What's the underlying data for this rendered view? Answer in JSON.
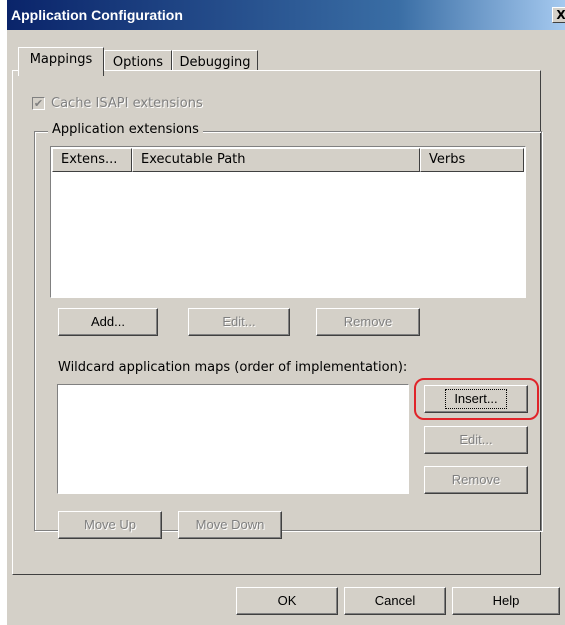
{
  "window": {
    "title": "Application Configuration",
    "close_label": "X"
  },
  "tabs": [
    {
      "label": "Mappings",
      "active": true
    },
    {
      "label": "Options",
      "active": false
    },
    {
      "label": "Debugging",
      "active": false
    }
  ],
  "cache_isapi": {
    "label": "Cache ISAPI extensions",
    "checked": true,
    "enabled": false
  },
  "app_extensions": {
    "group_label": "Application extensions",
    "columns": [
      "Extens...",
      "Executable Path",
      "Verbs"
    ],
    "rows": [],
    "add_label": "Add...",
    "edit_label": "Edit...",
    "remove_label": "Remove"
  },
  "wildcard": {
    "label": "Wildcard application maps (order of implementation):",
    "items": [],
    "insert_label": "Insert...",
    "edit_label": "Edit...",
    "remove_label": "Remove",
    "move_up_label": "Move Up",
    "move_down_label": "Move Down"
  },
  "footer": {
    "ok_label": "OK",
    "cancel_label": "Cancel",
    "help_label": "Help"
  },
  "colors": {
    "dialog_face": "#d4d0c8",
    "title_gradient_start": "#0a246a",
    "highlight_ring": "#e0242a"
  }
}
